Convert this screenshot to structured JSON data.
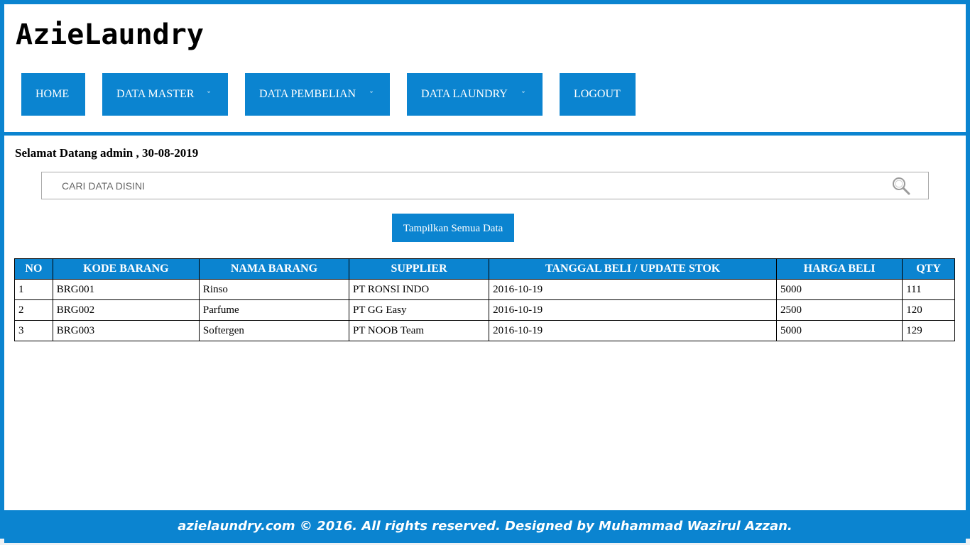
{
  "brand": "AzieLaundry",
  "nav": [
    {
      "label": "HOME",
      "dropdown": false
    },
    {
      "label": "DATA MASTER",
      "dropdown": true
    },
    {
      "label": "DATA PEMBELIAN",
      "dropdown": true
    },
    {
      "label": "DATA LAUNDRY",
      "dropdown": true
    },
    {
      "label": "LOGOUT",
      "dropdown": false
    }
  ],
  "caret": "ˇ",
  "welcome": "Selamat Datang admin , 30-08-2019",
  "search": {
    "placeholder": "CARI DATA DISINI",
    "value": ""
  },
  "show_all_label": "Tampilkan Semua Data",
  "table": {
    "headers": [
      "NO",
      "KODE BARANG",
      "NAMA BARANG",
      "SUPPLIER",
      "TANGGAL BELI / UPDATE STOK",
      "HARGA BELI",
      "QTY"
    ],
    "rows": [
      [
        "1",
        "BRG001",
        "Rinso",
        "PT RONSI INDO",
        "2016-10-19",
        "5000",
        "111"
      ],
      [
        "2",
        "BRG002",
        "Parfume",
        "PT GG Easy",
        "2016-10-19",
        "2500",
        "120"
      ],
      [
        "3",
        "BRG003",
        "Softergen",
        "PT NOOB Team",
        "2016-10-19",
        "5000",
        "129"
      ]
    ]
  },
  "footer": "azielaundry.com © 2016. All rights reserved. Designed by Muhammad Wazirul Azzan.",
  "colors": {
    "accent": "#0b84d0"
  },
  "icons": {
    "search": "search-icon",
    "dropdown": "chevron-down-icon"
  }
}
